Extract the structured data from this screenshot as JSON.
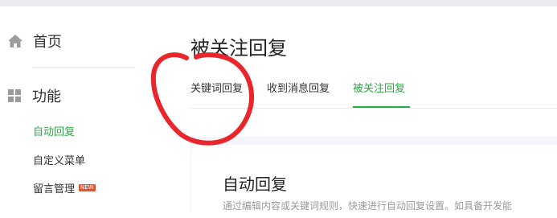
{
  "sidebar": {
    "home_label": "首页",
    "function_label": "功能",
    "items": [
      {
        "label": "自动回复",
        "active": true
      },
      {
        "label": "自定义菜单",
        "active": false
      },
      {
        "label": "留言管理",
        "active": false,
        "badge": "NEW"
      }
    ]
  },
  "main": {
    "title": "被关注回复",
    "tabs": [
      {
        "label": "关键词回复",
        "active": false
      },
      {
        "label": "收到消息回复",
        "active": false
      },
      {
        "label": "被关注回复",
        "active": true
      }
    ],
    "card": {
      "title": "自动回复",
      "description": "通过编辑内容或关键词规则，快速进行自动回复设置。如具备开发能"
    }
  },
  "colors": {
    "accent": "#2aa844",
    "annotation": "#e8262c",
    "badge": "#e6542f"
  },
  "icons": {
    "home": "home-icon",
    "function": "grid-icon"
  }
}
